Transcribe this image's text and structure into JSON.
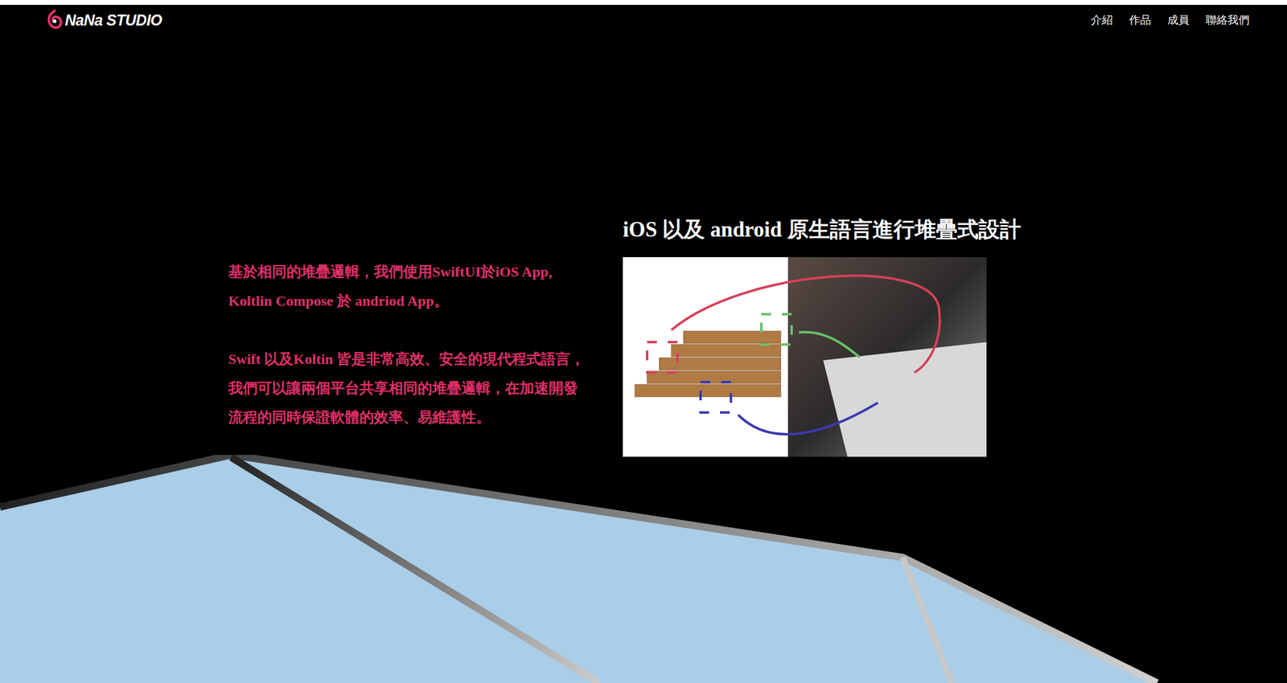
{
  "header": {
    "logo": {
      "text": "NaNa STUDIO"
    },
    "nav": [
      {
        "label": "介紹"
      },
      {
        "label": "作品"
      },
      {
        "label": "成員"
      },
      {
        "label": "聯絡我們"
      }
    ]
  },
  "hero": {
    "title": "iOS 以及 android 原生語言進行堆疊式設計",
    "paragraphs": [
      "基於相同的堆疊邏輯，我們使用SwiftUI於iOS App, Koltlin Compose 於 andriod App。",
      "Swift 以及Koltin 皆是非常高效、安全的現代程式語言，我們可以讓兩個平台共享相同的堆疊邏輯，在加速開發流程的同時保證軟體的效率、易維護性。"
    ]
  }
}
